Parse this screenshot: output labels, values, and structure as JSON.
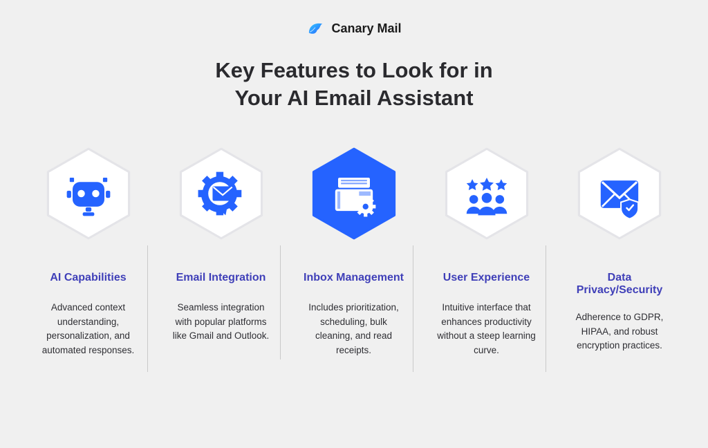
{
  "brand": {
    "name": "Canary Mail"
  },
  "title_line1": "Key Features to Look for in",
  "title_line2": "Your AI Email Assistant",
  "colors": {
    "accent": "#2563ff",
    "heading": "#3f3fb8",
    "body": "#2e2e33",
    "bg": "#f0f0f0",
    "hex_fill": "#ffffff"
  },
  "features": [
    {
      "id": "ai-capabilities",
      "icon": "robot-icon",
      "highlighted": false,
      "title": "AI Capabilities",
      "desc": "Advanced context understanding, personalization, and automated responses."
    },
    {
      "id": "email-integration",
      "icon": "gear-mail-icon",
      "highlighted": false,
      "title": "Email Integration",
      "desc": "Seamless integration with popular platforms like Gmail and Outlook."
    },
    {
      "id": "inbox-management",
      "icon": "inbox-gear-icon",
      "highlighted": true,
      "title": "Inbox Management",
      "desc": "Includes prioritization, scheduling, bulk cleaning, and read receipts."
    },
    {
      "id": "user-experience",
      "icon": "users-stars-icon",
      "highlighted": false,
      "title": "User Experience",
      "desc": "Intuitive interface that enhances productivity without a steep learning curve."
    },
    {
      "id": "data-privacy-security",
      "icon": "mail-shield-icon",
      "highlighted": false,
      "title": "Data Privacy/Security",
      "desc": "Adherence to GDPR, HIPAA, and robust encryption practices."
    }
  ]
}
